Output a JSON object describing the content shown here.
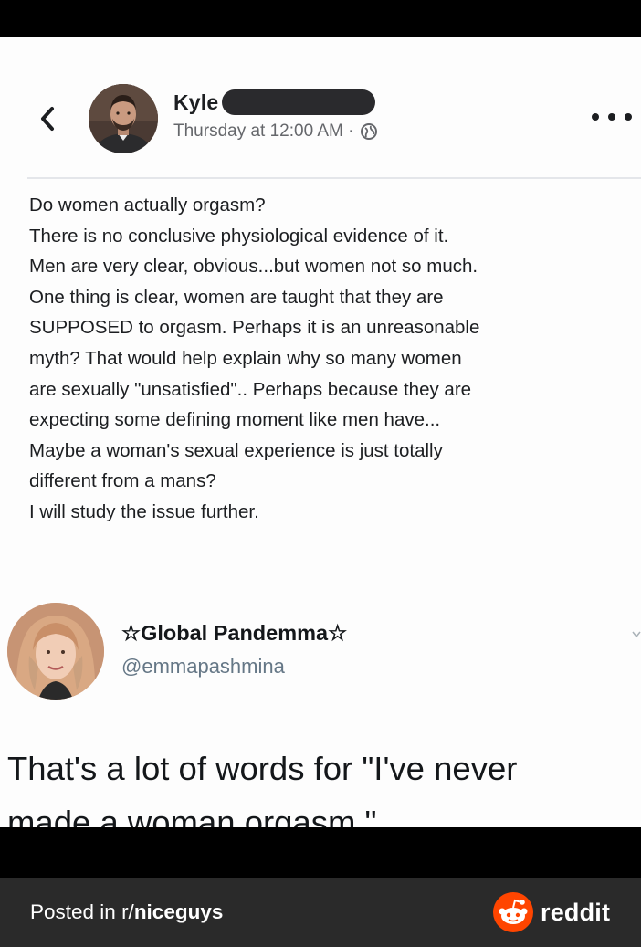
{
  "facebook_post": {
    "author_name": "Kyle",
    "timestamp": "Thursday at 12:00 AM ·",
    "body_lines": [
      "Do women actually orgasm?",
      "There is no conclusive physiological evidence of it.",
      "Men are very clear, obvious...but women not so much.",
      "One thing is clear, women are taught that they are",
      "SUPPOSED to orgasm.  Perhaps it is an unreasonable",
      "myth?  That would help explain why so many women",
      "are sexually \"unsatisfied\".. Perhaps because they are",
      "expecting some defining moment like men have...",
      "Maybe a woman's sexual experience is just totally",
      "different from a mans?",
      "I will study the issue further."
    ],
    "icons": [
      "chevron-left-icon",
      "globe-icon",
      "more-options-icon"
    ]
  },
  "tweet": {
    "display_name": "☆Global Pandemma☆",
    "handle": "@emmapashmina",
    "text_lines": [
      "That's a lot of words for \"I've never",
      "made a woman orgasm.\""
    ]
  },
  "footer": {
    "prefix": "Posted in r/",
    "subreddit": "niceguys",
    "brand": "reddit",
    "brand_color": "#ff4500"
  }
}
